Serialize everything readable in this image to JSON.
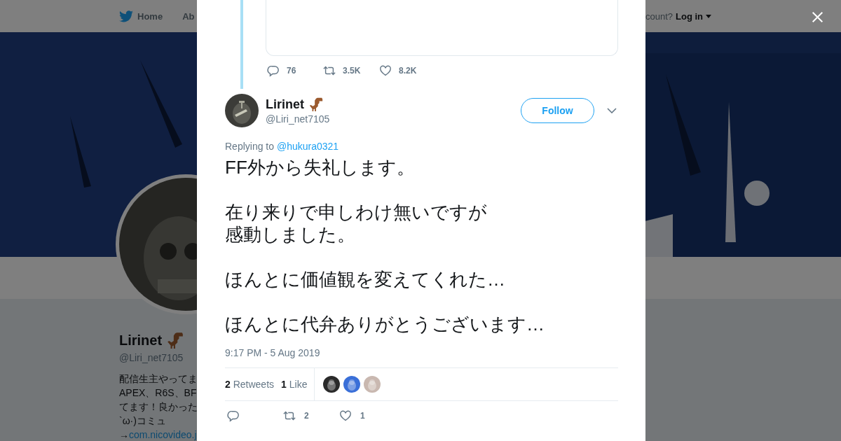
{
  "background_page": {
    "nav": {
      "items": [
        {
          "label": "Home",
          "kind": "home"
        },
        {
          "label": "Ab",
          "kind": "plain"
        }
      ],
      "login_prompt": "count?",
      "login_link": "Log in"
    },
    "profile": {
      "name": "Lirinet",
      "handle": "@Liri_net7105",
      "bio_lines": [
        "配信生主やってま",
        "APEX、R6S、BF",
        "てます！良かった",
        "`ω·)コミュ"
      ],
      "bio_arrow": "→",
      "bio_link": "com.nicovideo.j"
    }
  },
  "parent_tweet": {
    "actions": [
      {
        "kind": "reply",
        "count": "76"
      },
      {
        "kind": "retweet",
        "count": "3.5K"
      },
      {
        "kind": "like",
        "count": "8.2K"
      }
    ]
  },
  "tweet": {
    "name": "Lirinet",
    "handle": "@Liri_net7105",
    "follow_label": "Follow",
    "replying_prefix": "Replying to",
    "replying_to": "@hukura0321",
    "paragraphs": [
      {
        "lines": [
          "FF外から失礼します。"
        ]
      },
      {
        "lines": [
          "在り来りで申しわけ無いですが",
          "感動しました。"
        ]
      },
      {
        "lines": [
          "ほんとに価値観を変えてくれた…"
        ]
      },
      {
        "lines": [
          "ほんとに代弁ありがとうございます…"
        ]
      }
    ],
    "timestamp": "9:17 PM - 5 Aug 2019",
    "stats": [
      {
        "count": "2",
        "label": "Retweets"
      },
      {
        "count": "1",
        "label": "Like"
      }
    ],
    "actions": [
      {
        "kind": "reply"
      },
      {
        "kind": "retweet",
        "count": "2"
      },
      {
        "kind": "like",
        "count": "1"
      }
    ]
  }
}
